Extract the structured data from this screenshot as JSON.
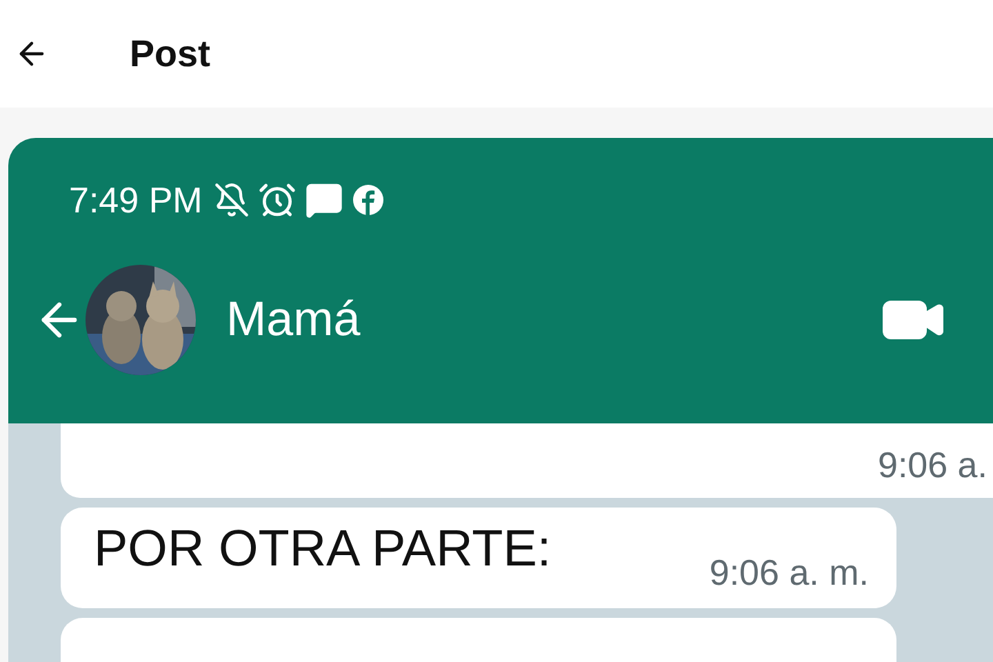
{
  "top_bar": {
    "title": "Post"
  },
  "screenshot": {
    "status_bar": {
      "time": "7:49 PM"
    },
    "chat_header": {
      "contact": "Mamá"
    },
    "messages": [
      {
        "kind": "cut_top",
        "time": "9:06 a."
      },
      {
        "kind": "full",
        "text": "POR OTRA PARTE:",
        "time": "9:06 a. m."
      },
      {
        "kind": "cut_bottom"
      }
    ]
  }
}
